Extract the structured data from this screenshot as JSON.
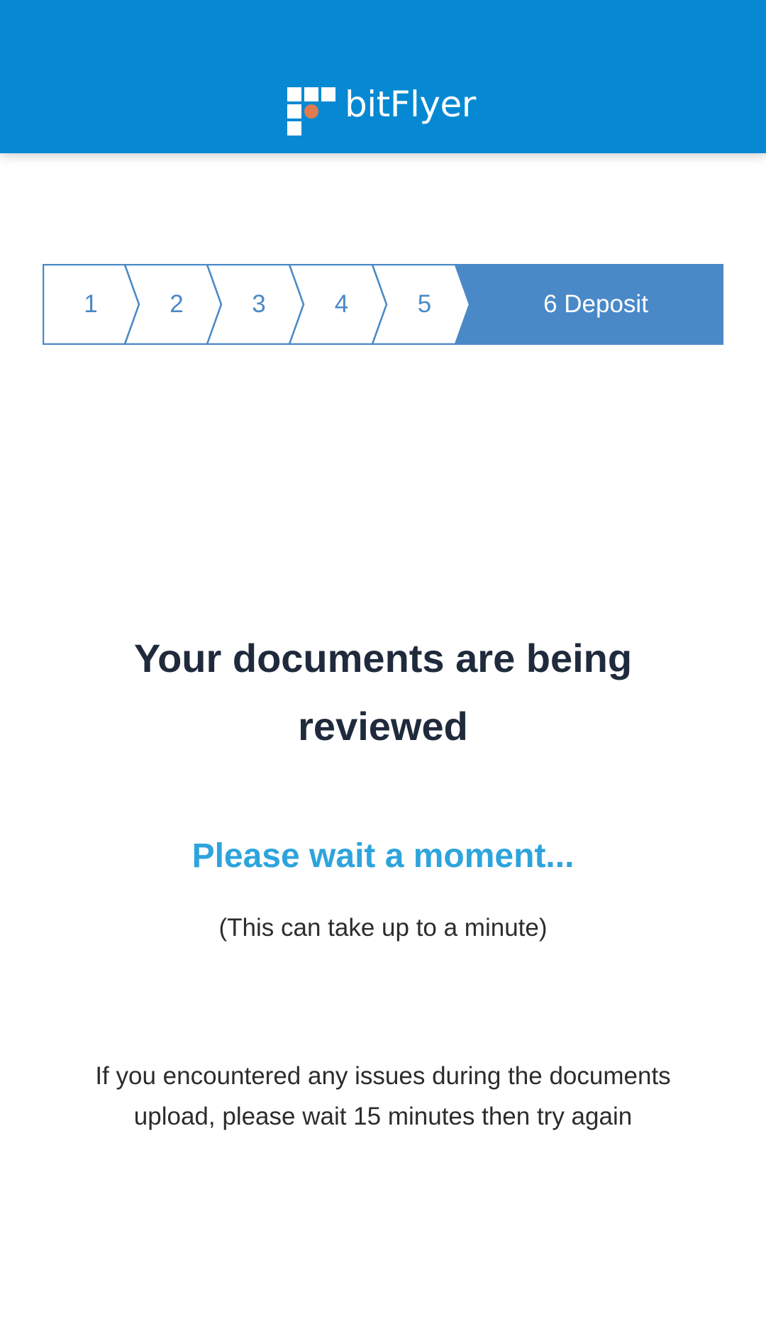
{
  "header": {
    "brand": "bitFlyer",
    "background_color": "#0689d2",
    "logo_accent_color": "#e07b4f"
  },
  "stepper": {
    "current_step": 6,
    "accent_color": "#4a89c8",
    "steps": [
      {
        "label": "1"
      },
      {
        "label": "2"
      },
      {
        "label": "3"
      },
      {
        "label": "4"
      },
      {
        "label": "5"
      },
      {
        "label": "6 Deposit"
      }
    ]
  },
  "main": {
    "title": "Your documents are being reviewed",
    "wait_text": "Please wait a moment...",
    "wait_note": "(This can take up to a minute)",
    "issues_text": "If you encountered any issues during the documents upload, please wait 15 minutes then try again"
  }
}
